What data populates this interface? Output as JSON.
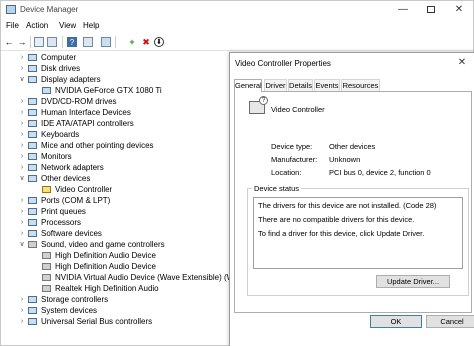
{
  "window": {
    "title": "Device Manager",
    "minimize_glyph": "—",
    "close_glyph": "✕"
  },
  "menu": [
    "File",
    "Action",
    "View",
    "Help"
  ],
  "toolbar": {
    "back_glyph": "←",
    "forward_glyph": "→",
    "help_glyph": "?",
    "add_glyph": "+",
    "remove_glyph": "✖",
    "update_glyph": "⬇",
    "remove_color": "#d01010",
    "add_color": "#2a8a2a"
  },
  "tree": {
    "expanded_glyph": "∨",
    "collapsed_glyph": "›",
    "items": [
      {
        "label": "Computer",
        "icon": "computer-icon"
      },
      {
        "label": "Disk drives",
        "icon": "disk-icon"
      },
      {
        "label": "Display adapters",
        "icon": "display-adapter-icon"
      },
      {
        "label": "NVIDIA GeForce GTX 1080 Ti",
        "icon": "display-adapter-icon"
      },
      {
        "label": "DVD/CD-ROM drives",
        "icon": "dvd-icon"
      },
      {
        "label": "Human Interface Devices",
        "icon": "hid-icon"
      },
      {
        "label": "IDE ATA/ATAPI controllers",
        "icon": "ide-icon"
      },
      {
        "label": "Keyboards",
        "icon": "keyboard-icon"
      },
      {
        "label": "Mice and other pointing devices",
        "icon": "mouse-icon"
      },
      {
        "label": "Monitors",
        "icon": "monitor-icon"
      },
      {
        "label": "Network adapters",
        "icon": "network-icon"
      },
      {
        "label": "Other devices",
        "icon": "other-devices-icon"
      },
      {
        "label": "Video Controller",
        "icon": "warning-device-icon"
      },
      {
        "label": "Ports (COM & LPT)",
        "icon": "port-icon"
      },
      {
        "label": "Print queues",
        "icon": "printer-icon"
      },
      {
        "label": "Processors",
        "icon": "processor-icon"
      },
      {
        "label": "Software devices",
        "icon": "software-device-icon"
      },
      {
        "label": "Sound, video and game controllers",
        "icon": "speaker-icon"
      },
      {
        "label": "High Definition Audio Device",
        "icon": "speaker-icon"
      },
      {
        "label": "High Definition Audio Device",
        "icon": "speaker-icon"
      },
      {
        "label": "NVIDIA Virtual Audio Device (Wave Extensible) (WDM)",
        "icon": "speaker-icon"
      },
      {
        "label": "Realtek High Definition Audio",
        "icon": "speaker-icon"
      },
      {
        "label": "Storage controllers",
        "icon": "storage-icon"
      },
      {
        "label": "System devices",
        "icon": "system-icon"
      },
      {
        "label": "Universal Serial Bus controllers",
        "icon": "usb-icon"
      }
    ]
  },
  "properties": {
    "title": "Video Controller Properties",
    "close_glyph": "✕",
    "tabs": [
      "General",
      "Driver",
      "Details",
      "Events",
      "Resources"
    ],
    "active_tab": "General",
    "device_name": "Video Controller",
    "icon_glyph": "?",
    "fields": [
      {
        "label": "Device type:",
        "value": "Other devices"
      },
      {
        "label": "Manufacturer:",
        "value": "Unknown"
      },
      {
        "label": "Location:",
        "value": "PCI bus 0, device 2, function 0"
      }
    ],
    "status_label": "Device status",
    "status_lines": [
      "The drivers for this device are not installed. (Code 28)",
      "",
      "There are no compatible drivers for this device.",
      "",
      "To find a driver for this device, click Update Driver."
    ],
    "update_driver_label": "Update Driver...",
    "ok_label": "OK",
    "cancel_label": "Cancel"
  }
}
